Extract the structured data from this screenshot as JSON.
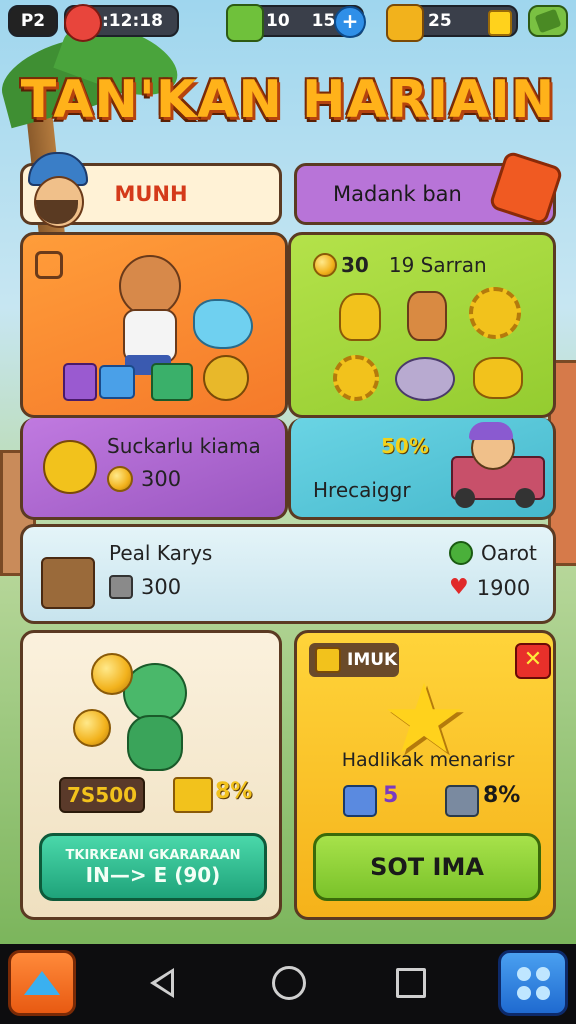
{
  "topbar": {
    "badge": "P2",
    "timer": ":12:18",
    "gems_a": "10",
    "gems_b": "159",
    "coins": "25"
  },
  "title": "TAN'KAN HARIAIN",
  "tabs": [
    {
      "label": "MUNH"
    },
    {
      "label": "Madank ban"
    }
  ],
  "cards": {
    "top_right_header_count": "30",
    "top_right_header_label": "19 Sarran",
    "mid_left_title": "Suckarlu kiama",
    "mid_left_value": "300",
    "mid_right_percent": "50%",
    "mid_right_title": "Hrecaiggr",
    "wide_title": "Peal Karys",
    "wide_value": "300",
    "wide_right_label": "Oarot",
    "wide_right_value": "1900",
    "bottom_left_price": "7S500",
    "bottom_left_percent": "8%",
    "bottom_left_button_line1": "TKIRKEANI GKARARAAN",
    "bottom_left_button_line2": "IN—> E (90)",
    "bottom_right_header": "IMUK",
    "bottom_right_title": "Hadlikak menarisr",
    "bottom_right_percent": "8%",
    "bottom_right_button": "SOT IMA"
  },
  "colors": {
    "orange_card": "#f7913a",
    "green_card": "#a5d63a",
    "purple_card": "#b06fd0",
    "teal_card": "#58c8d8",
    "gold_card": "#f7c72a",
    "teal_button": "#2fc99a",
    "green_button": "#8ed23a"
  },
  "icons": [
    "clock-icon",
    "puzzle-icon",
    "plus-icon",
    "treasure-icon",
    "gold-bar-icon",
    "map-icon",
    "up-arrow-icon",
    "back-icon",
    "home-icon",
    "recents-icon",
    "menu-grid-icon",
    "close-icon",
    "star-icon",
    "heart-icon"
  ]
}
